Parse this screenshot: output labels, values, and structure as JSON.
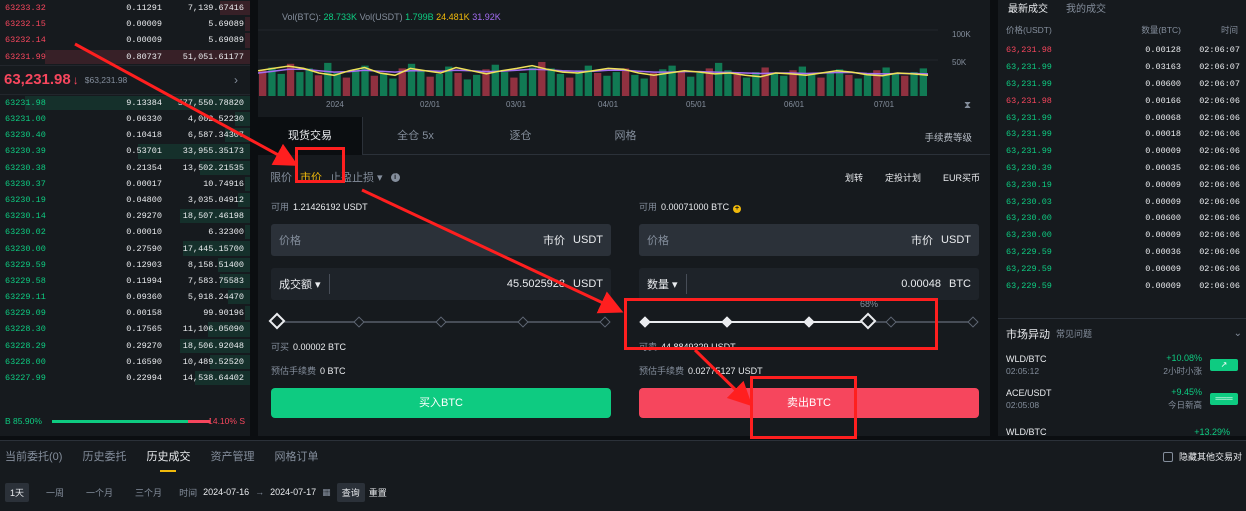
{
  "colors": {
    "green": "#0ecb81",
    "red": "#f6465d",
    "yellow": "#f0b90b",
    "annotation": "#ff1f1f"
  },
  "orderbook": {
    "asks": [
      {
        "price": "63233.32",
        "qty": "0.11291",
        "total": "7,139.67416",
        "depth": 0.12
      },
      {
        "price": "63232.15",
        "qty": "0.00009",
        "total": "5.69089",
        "depth": 0.02
      },
      {
        "price": "63232.14",
        "qty": "0.00009",
        "total": "5.69089",
        "depth": 0.02
      },
      {
        "price": "63231.99",
        "qty": "0.80737",
        "total": "51,051.61177",
        "depth": 0.82
      }
    ],
    "mid": {
      "price": "63,231.98",
      "arrow": "↓",
      "sub": "$63,231.98",
      "chevron": "›"
    },
    "bids": [
      {
        "price": "63231.98",
        "qty": "9.13384",
        "total": "577,550.78820",
        "depth": 0.9
      },
      {
        "price": "63231.00",
        "qty": "0.06330",
        "total": "4,002.52230",
        "depth": 0.06
      },
      {
        "price": "63230.40",
        "qty": "0.10418",
        "total": "6,587.34307",
        "depth": 0.1
      },
      {
        "price": "63230.39",
        "qty": "0.53701",
        "total": "33,955.35173",
        "depth": 0.45
      },
      {
        "price": "63230.38",
        "qty": "0.21354",
        "total": "13,502.21535",
        "depth": 0.2
      },
      {
        "price": "63230.37",
        "qty": "0.00017",
        "total": "10.74916",
        "depth": 0.02
      },
      {
        "price": "63230.19",
        "qty": "0.04800",
        "total": "3,035.04912",
        "depth": 0.05
      },
      {
        "price": "63230.14",
        "qty": "0.29270",
        "total": "18,507.46198",
        "depth": 0.28
      },
      {
        "price": "63230.02",
        "qty": "0.00010",
        "total": "6.32300",
        "depth": 0.02
      },
      {
        "price": "63230.00",
        "qty": "0.27590",
        "total": "17,445.15700",
        "depth": 0.27
      },
      {
        "price": "63229.59",
        "qty": "0.12903",
        "total": "8,158.51400",
        "depth": 0.13
      },
      {
        "price": "63229.58",
        "qty": "0.11994",
        "total": "7,583.75583",
        "depth": 0.12
      },
      {
        "price": "63229.11",
        "qty": "0.09360",
        "total": "5,918.24470",
        "depth": 0.09
      },
      {
        "price": "63229.09",
        "qty": "0.00158",
        "total": "99.90196",
        "depth": 0.02
      },
      {
        "price": "63228.30",
        "qty": "0.17565",
        "total": "11,106.05090",
        "depth": 0.17
      },
      {
        "price": "63228.29",
        "qty": "0.29270",
        "total": "18,506.92048",
        "depth": 0.28
      },
      {
        "price": "63228.00",
        "qty": "0.16590",
        "total": "10,489.52520",
        "depth": 0.16
      },
      {
        "price": "63227.99",
        "qty": "0.22994",
        "total": "14,538.64402",
        "depth": 0.22
      }
    ],
    "ratio": {
      "buy_label": "B",
      "buy": "85.90%",
      "sell": "14.10%",
      "sell_label": "S",
      "buy_fraction": 0.859
    }
  },
  "chart": {
    "legend": {
      "vol_btc_label": "Vol(BTC):",
      "vol_btc": "28.733K",
      "vol_usdt_label": "Vol(USDT)",
      "vol_usdt_1": "1.799B",
      "vol_usdt_2": "24.481K",
      "vol_usdt_3": "31.92K"
    },
    "y_ticks": [
      "100K",
      "50K"
    ],
    "x_ticks": [
      "2024",
      "02/01",
      "03/01",
      "04/01",
      "05/01",
      "06/01",
      "07/01"
    ],
    "vol_series": [
      0.55,
      0.62,
      0.48,
      0.7,
      0.52,
      0.6,
      0.45,
      0.72,
      0.5,
      0.4,
      0.58,
      0.66,
      0.44,
      0.5,
      0.38,
      0.6,
      0.7,
      0.55,
      0.42,
      0.48,
      0.64,
      0.5,
      0.36,
      0.46,
      0.58,
      0.68,
      0.52,
      0.4,
      0.5,
      0.62,
      0.74,
      0.6,
      0.48,
      0.4,
      0.56,
      0.66,
      0.5,
      0.44,
      0.52,
      0.6,
      0.46,
      0.38,
      0.5,
      0.58,
      0.66,
      0.54,
      0.42,
      0.5,
      0.6,
      0.72,
      0.56,
      0.46,
      0.4,
      0.52,
      0.62,
      0.5,
      0.44,
      0.56,
      0.64,
      0.48,
      0.4,
      0.5,
      0.58,
      0.46,
      0.38,
      0.48,
      0.56,
      0.62,
      0.5,
      0.44,
      0.52,
      0.6
    ],
    "ma_yellow": [
      0.55,
      0.6,
      0.65,
      0.6,
      0.5,
      0.45,
      0.55,
      0.62,
      0.5,
      0.45,
      0.6,
      0.55,
      0.5,
      0.62,
      0.55,
      0.48,
      0.55,
      0.6,
      0.66,
      0.58,
      0.52,
      0.5,
      0.55,
      0.6,
      0.58,
      0.5,
      0.45,
      0.5,
      0.55,
      0.52,
      0.48,
      0.5,
      0.45,
      0.42,
      0.5,
      0.48,
      0.45,
      0.5,
      0.55,
      0.52,
      0.46,
      0.44,
      0.5,
      0.48,
      0.45
    ],
    "ma_purple": [
      0.5,
      0.54,
      0.58,
      0.58,
      0.55,
      0.52,
      0.53,
      0.56,
      0.54,
      0.52,
      0.55,
      0.55,
      0.54,
      0.56,
      0.55,
      0.53,
      0.54,
      0.56,
      0.58,
      0.57,
      0.55,
      0.54,
      0.54,
      0.56,
      0.56,
      0.54,
      0.52,
      0.52,
      0.53,
      0.53,
      0.52,
      0.51,
      0.5,
      0.49,
      0.5,
      0.5,
      0.49,
      0.5,
      0.51,
      0.51,
      0.49,
      0.48,
      0.49,
      0.49,
      0.48
    ]
  },
  "trade": {
    "tabs": [
      "现货交易",
      "全仓 5x",
      "逐仓",
      "网格"
    ],
    "fee_tier": "手续费等级",
    "order_types": {
      "limit": "限价",
      "market": "市价",
      "stop": "止盈止损 ▾",
      "info": "i"
    },
    "links": [
      "划转",
      "定投计划",
      "EUR买币"
    ],
    "buy": {
      "avail_label": "可用",
      "avail_value": "1.21426192 USDT",
      "price_label": "价格",
      "price_value": "市价",
      "price_unit": "USDT",
      "amount_label": "成交额 ▾",
      "amount_value": "45.5025928",
      "amount_unit": "USDT",
      "can_label": "可买",
      "can_value": "0.00002 BTC",
      "fee_label": "预估手续费",
      "fee_value": "0 BTC",
      "button": "买入BTC"
    },
    "sell": {
      "avail_label": "可用",
      "avail_value": "0.00071000 BTC",
      "price_label": "价格",
      "price_value": "市价",
      "price_unit": "USDT",
      "amount_label": "数量 ▾",
      "amount_value": "0.00048",
      "amount_unit": "BTC",
      "slider_pct": "68%",
      "slider_fraction": 0.68,
      "can_label": "可卖",
      "can_value": "44.8849329 USDT",
      "fee_label": "预估手续费",
      "fee_value": "0.02775127 USDT",
      "button": "卖出BTC"
    }
  },
  "trades": {
    "tabs": [
      "最新成交",
      "我的成交"
    ],
    "headers": [
      "价格(USDT)",
      "数量(BTC)",
      "时间"
    ],
    "rows": [
      {
        "price": "63,231.98",
        "qty": "0.00128",
        "time": "02:06:07",
        "dir": "dn"
      },
      {
        "price": "63,231.99",
        "qty": "0.03163",
        "time": "02:06:07",
        "dir": "up"
      },
      {
        "price": "63,231.99",
        "qty": "0.00600",
        "time": "02:06:07",
        "dir": "up"
      },
      {
        "price": "63,231.98",
        "qty": "0.00166",
        "time": "02:06:06",
        "dir": "dn"
      },
      {
        "price": "63,231.99",
        "qty": "0.00068",
        "time": "02:06:06",
        "dir": "up"
      },
      {
        "price": "63,231.99",
        "qty": "0.00018",
        "time": "02:06:06",
        "dir": "up"
      },
      {
        "price": "63,231.99",
        "qty": "0.00009",
        "time": "02:06:06",
        "dir": "up"
      },
      {
        "price": "63,230.39",
        "qty": "0.00035",
        "time": "02:06:06",
        "dir": "up"
      },
      {
        "price": "63,230.19",
        "qty": "0.00009",
        "time": "02:06:06",
        "dir": "up"
      },
      {
        "price": "63,230.03",
        "qty": "0.00009",
        "time": "02:06:06",
        "dir": "up"
      },
      {
        "price": "63,230.00",
        "qty": "0.00600",
        "time": "02:06:06",
        "dir": "up"
      },
      {
        "price": "63,230.00",
        "qty": "0.00009",
        "time": "02:06:06",
        "dir": "up"
      },
      {
        "price": "63,229.59",
        "qty": "0.00036",
        "time": "02:06:06",
        "dir": "up"
      },
      {
        "price": "63,229.59",
        "qty": "0.00009",
        "time": "02:06:06",
        "dir": "up"
      },
      {
        "price": "63,229.59",
        "qty": "0.00009",
        "time": "02:06:06",
        "dir": "up"
      }
    ],
    "market": {
      "title": "市场异动",
      "subtitle": "常见问题",
      "icon": "⌄",
      "rows": [
        {
          "sym": "WLD/BTC",
          "time": "02:05:12",
          "change": "+10.08%",
          "desc": "2小时小涨",
          "badge": "↗"
        },
        {
          "sym": "ACE/USDT",
          "time": "02:05:08",
          "change": "+9.45%",
          "desc": "今日新高",
          "badge": "═══"
        },
        {
          "sym": "WLD/BTC",
          "time": "",
          "change": "+13.29%",
          "desc": "",
          "badge": ""
        }
      ]
    }
  },
  "bottom": {
    "tabs": [
      "当前委托(0)",
      "历史委托",
      "历史成交",
      "资产管理",
      "网格订单"
    ],
    "hide_label": "隐藏其他交易对",
    "ranges": [
      "1天",
      "一周",
      "一个月",
      "三个月"
    ],
    "time_label": "时间",
    "date_from": "2024-07-16",
    "arrow": "→",
    "date_to": "2024-07-17",
    "cal_icon": "▦",
    "query": "查询",
    "reset": "重置"
  }
}
